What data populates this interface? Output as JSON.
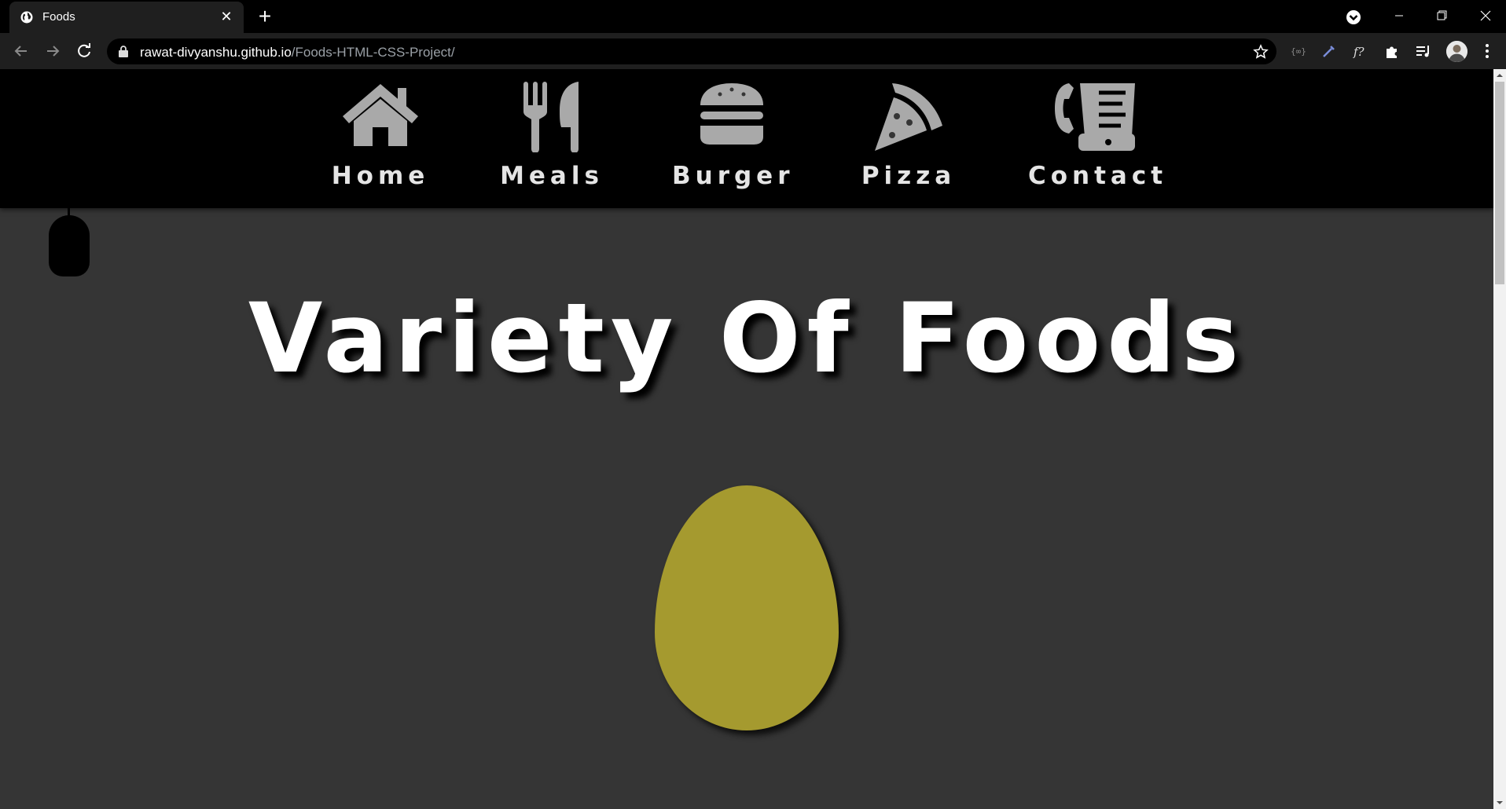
{
  "browser": {
    "tab": {
      "title": "Foods",
      "favicon": "globe-icon"
    },
    "new_tab_symbol": "+",
    "close_symbol": "✕",
    "address": {
      "domain": "rawat-divyanshu.github.io",
      "path": "/Foods-HTML-CSS-Project/"
    }
  },
  "nav": {
    "items": [
      {
        "label": "Home",
        "icon": "home-icon"
      },
      {
        "label": "Meals",
        "icon": "utensils-icon"
      },
      {
        "label": "Burger",
        "icon": "burger-icon"
      },
      {
        "label": "Pizza",
        "icon": "pizza-icon"
      },
      {
        "label": "Contact",
        "icon": "fax-phone-icon"
      }
    ]
  },
  "hero": {
    "title": "Variety Of Foods"
  },
  "colors": {
    "page_background": "#353535",
    "nav_background": "#000000",
    "nav_icon": "#a9a9a9",
    "egg": "#a59a2f"
  }
}
